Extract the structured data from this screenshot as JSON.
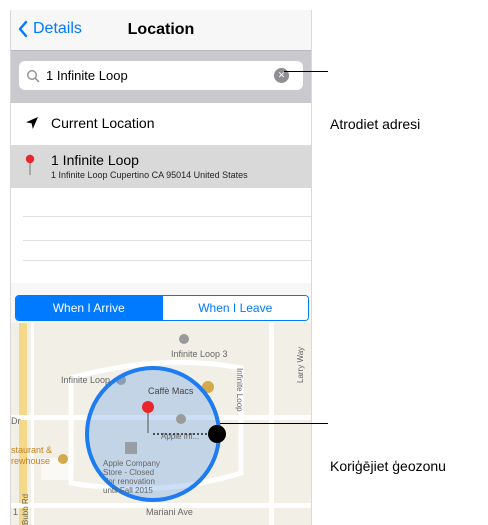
{
  "nav": {
    "back_label": "Details",
    "title": "Location"
  },
  "search": {
    "value": "1 Infinite Loop"
  },
  "results": [
    {
      "title": "Current Location"
    },
    {
      "title": "1 Infinite Loop",
      "subtitle": "1 Infinite Loop Cupertino CA 95014 United States"
    }
  ],
  "segment": {
    "option1": "When I Arrive",
    "option2": "When I Leave",
    "selected": "When I Arrive"
  },
  "map_labels": {
    "infinite_loop_3": "Infinite Loop 3",
    "infinite_loop_left": "Infinite Loop",
    "caffe": "Caffè Macs",
    "infinite_loop_vertical": "Infinite Loop",
    "larry_way": "Larry Way",
    "dr": "Dr",
    "restaurant1": "staurant &",
    "restaurant2": "rewhouse",
    "apple_store_1": "Apple Company",
    "apple_store_2": "Store - Closed",
    "apple_store_3": "for renovation",
    "apple_store_4": "until Fall 2015",
    "apple_marker": "Apple Inf...",
    "mariani": "Mariani Ave",
    "bottom_left": "Bubb Rd",
    "bottom_num": "1"
  },
  "callouts": {
    "address": "Atrodiet adresi",
    "geofence": "Koriģējiet ģeozonu"
  },
  "colors": {
    "accent": "#007aff",
    "pin": "#e8262b",
    "geofence": "#1e7cf2"
  }
}
